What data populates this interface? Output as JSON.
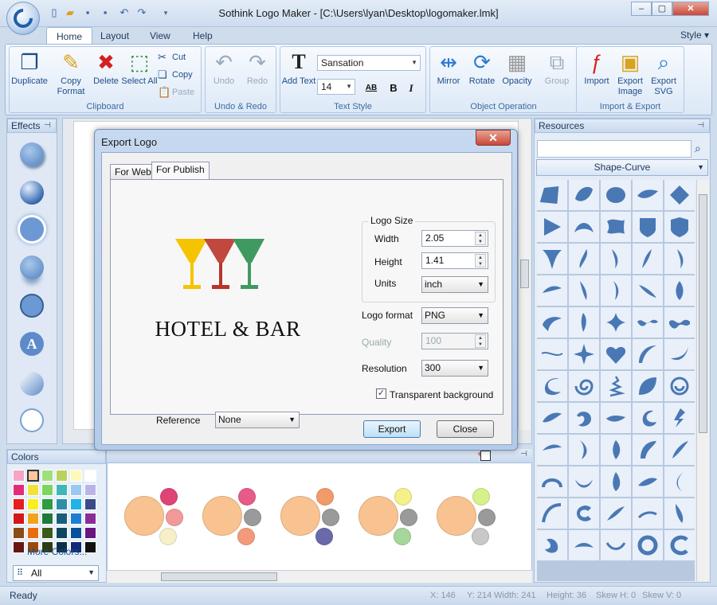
{
  "window": {
    "title": "Sothink Logo Maker - [C:\\Users\\lyan\\Desktop\\logomaker.lmk]",
    "min": "–",
    "max": "▢",
    "close": "✕"
  },
  "ribbon_tabs": [
    "Home",
    "Layout",
    "View",
    "Help"
  ],
  "style_menu": "Style ▾",
  "clipboard": {
    "group": "Clipboard",
    "duplicate": "Duplicate",
    "copy_format": "Copy Format",
    "delete": "Delete",
    "select_all": "Select All",
    "cut": "Cut",
    "copy": "Copy",
    "paste": "Paste"
  },
  "undo_redo": {
    "group": "Undo & Redo",
    "undo": "Undo",
    "redo": "Redo"
  },
  "text_style": {
    "group": "Text Style",
    "add_text": "Add Text",
    "font": "Sansation",
    "size": "14",
    "bold": "B",
    "italic": "I",
    "ab": "AB"
  },
  "object_op": {
    "group": "Object Operation",
    "mirror": "Mirror",
    "rotate": "Rotate",
    "opacity": "Opacity",
    "group_btn": "Group"
  },
  "import_export": {
    "group": "Import & Export",
    "import": "Import",
    "export_image": "Export Image",
    "export_svg": "Export SVG"
  },
  "effects_panel": {
    "title": "Effects"
  },
  "resources_panel": {
    "title": "Resources",
    "category": "Shape-Curve",
    "search_value": ""
  },
  "colors_panel": {
    "title": "Colors",
    "more": "More Colors...",
    "filter": "All"
  },
  "palette": [
    "#f5a4c4",
    "#f9c79c",
    "#9ee07a",
    "#b9d25a",
    "#fff9b8",
    "#ffffff",
    "#e22c7a",
    "#f3e03a",
    "#7cd55d",
    "#3fb7b6",
    "#9ac8f0",
    "#b9b4e8",
    "#e81d1d",
    "#f7ef1f",
    "#2f9c3e",
    "#2e8ea8",
    "#1fb3e6",
    "#3c4a8a",
    "#d21818",
    "#f0a41d",
    "#1f7a3a",
    "#185f7c",
    "#1b7fd1",
    "#8a2b9a",
    "#8c4a14",
    "#e86e0d",
    "#3d5a1a",
    "#0e4660",
    "#0b4f9a",
    "#6a1580",
    "#6b1414",
    "#9c4a0a",
    "#2e3a14",
    "#0a2f4a",
    "#0e2a72",
    "#111111"
  ],
  "fill_sets": [
    {
      "main": "#f9c391",
      "a": "#e04477",
      "b": "#f29a9a",
      "c": "#f6f0c8"
    },
    {
      "main": "#f9c391",
      "a": "#e85a88",
      "b": "#9a9a9a",
      "c": "#f29a7a"
    },
    {
      "main": "#f9c391",
      "a": "#f29a6a",
      "b": "#9a9a9a",
      "c": "#6a6aaa"
    },
    {
      "main": "#f9c391",
      "a": "#f4f08a",
      "b": "#9a9a9a",
      "c": "#a6d69a"
    },
    {
      "main": "#f9c391",
      "a": "#d8f08a",
      "b": "#9a9a9a",
      "c": "#c8c8c8"
    }
  ],
  "dialog": {
    "title": "Export Logo",
    "close": "✕",
    "tabs": [
      "For Web",
      "For Publish"
    ],
    "logo_text": "HOTEL & BAR",
    "logo_colors": [
      "#f5c400",
      "#b9342a",
      "#3f9a60",
      "#a5902a"
    ],
    "logo_size_label": "Logo Size",
    "width_label": "Width",
    "width_value": "2.05",
    "height_label": "Height",
    "height_value": "1.41",
    "units_label": "Units",
    "units_value": "inch",
    "format_label": "Logo format",
    "format_value": "PNG",
    "quality_label": "Quality",
    "quality_value": "100",
    "resolution_label": "Resolution",
    "resolution_value": "300",
    "transparent_label": "Transparent background",
    "transparent_checked": true,
    "reference_label": "Reference",
    "reference_value": "None",
    "export_btn": "Export",
    "close_btn": "Close"
  },
  "status": {
    "ready": "Ready",
    "x": "X: 146",
    "y": "Y: 214",
    "width": "Width: 241",
    "height": "Height: 36",
    "skew_h": "Skew H: 0",
    "skew_v": "Skew V: 0"
  }
}
